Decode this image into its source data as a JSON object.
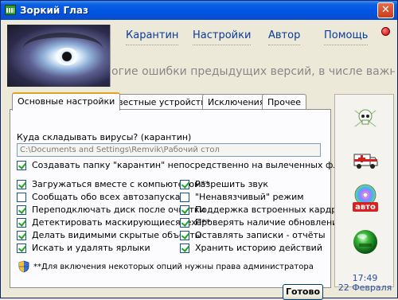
{
  "window": {
    "title": "Зоркий Глаз",
    "close_glyph": "✕"
  },
  "nav": {
    "items": [
      "Карантин",
      "Настройки",
      "Автор",
      "Помощь"
    ]
  },
  "ticker": {
    "text": "огие ошибки предыдущих версий, в числе важных - бро"
  },
  "tabs": [
    "Основные настройки",
    "Известные устройства",
    "Исключения",
    "Прочее"
  ],
  "active_tab": "Основные настройки",
  "quarantine": {
    "question": "Куда складывать вирусы? (карантин)",
    "path": "C:\\Documents and Settings\\Remvik\\Рабочий стол"
  },
  "checkboxes": {
    "create_folder": {
      "label": "Создавать папку \"карантин\" непосредственно на вылеченных флешках",
      "checked": true
    },
    "left": [
      {
        "label": "Загружаться вместе с компьютером**",
        "checked": true
      },
      {
        "label": "Сообщать обо всех автозапусках",
        "checked": false
      },
      {
        "label": "Переподключать диск после очистки",
        "checked": true
      },
      {
        "label": "Детектировать маскирующиеся .exe**",
        "checked": true
      },
      {
        "label": "Делать видимыми скрытые объекты",
        "checked": true
      },
      {
        "label": "Искать и удалять ярлыки",
        "checked": true
      }
    ],
    "right": [
      {
        "label": "Разрешить звук",
        "checked": true
      },
      {
        "label": "\"Ненавязчивый\" режим",
        "checked": false
      },
      {
        "label": "Поддержка встроенных кардридеров",
        "checked": true
      },
      {
        "label": "Проверять наличие обновлений",
        "checked": true
      },
      {
        "label": "Оставлять записки - отчёты",
        "checked": true
      },
      {
        "label": "Хранить историю действий",
        "checked": true
      }
    ]
  },
  "footer": {
    "note": "**Для включения некоторых опций нужны права администратора",
    "done_button": "Готово"
  },
  "side": {
    "icons": [
      "skull-crossbones-icon",
      "ambulance-icon",
      "cd-auto-icon",
      "green-orb-icon"
    ],
    "auto_label": "авто",
    "time": "17:49",
    "date": "22 Февраля"
  },
  "colors": {
    "titlebar": "#0054e3",
    "nav_link": "#0a3a9a",
    "clock": "#2a4fa0",
    "check": "#21a121"
  }
}
